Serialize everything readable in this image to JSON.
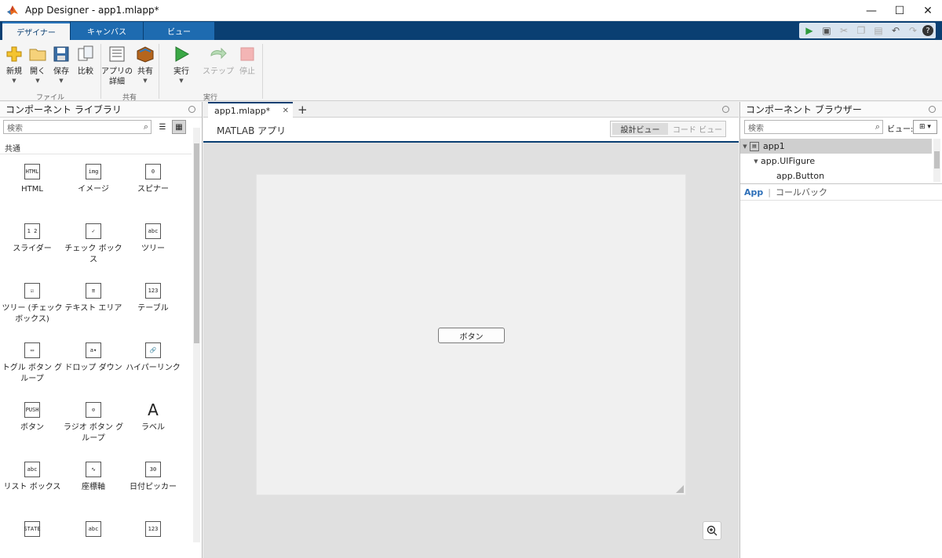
{
  "window": {
    "title": "App Designer - app1.mlapp*"
  },
  "main_tabs": [
    "デザイナー",
    "キャンバス",
    "ビュー"
  ],
  "ribbon": {
    "file_buttons": [
      {
        "label": "新規"
      },
      {
        "label": "開く"
      },
      {
        "label": "保存"
      },
      {
        "label": "比較"
      }
    ],
    "share_buttons": [
      {
        "label": "アプリの\n詳細"
      },
      {
        "label": "共有"
      }
    ],
    "run_buttons": [
      {
        "label": "実行"
      },
      {
        "label": "ステップ"
      },
      {
        "label": "停止"
      }
    ],
    "groups": {
      "file": "ファイル",
      "share": "共有",
      "run": "実行"
    }
  },
  "component_library": {
    "title": "コンポーネント ライブラリ",
    "search_placeholder": "検索",
    "section": "共通",
    "components": [
      {
        "label": "HTML",
        "icon": "HTML"
      },
      {
        "label": "イメージ",
        "icon": "img"
      },
      {
        "label": "スピナー",
        "icon": "0"
      },
      {
        "label": "スライダー",
        "icon": "1 2"
      },
      {
        "label": "チェック ボックス",
        "icon": "✓"
      },
      {
        "label": "ツリー",
        "icon": "abc"
      },
      {
        "label": "ツリー (チェック ボックス)",
        "icon": "☑"
      },
      {
        "label": "テキスト エリア",
        "icon": "≡"
      },
      {
        "label": "テーブル",
        "icon": "123"
      },
      {
        "label": "トグル ボタン グループ",
        "icon": "▭"
      },
      {
        "label": "ドロップ ダウン",
        "icon": "a▾"
      },
      {
        "label": "ハイパーリンク",
        "icon": "🔗"
      },
      {
        "label": "ボタン",
        "icon": "PUSH"
      },
      {
        "label": "ラジオ ボタン グループ",
        "icon": "⊙"
      },
      {
        "label": "ラベル",
        "icon": "A"
      },
      {
        "label": "リスト ボックス",
        "icon": "abc"
      },
      {
        "label": "座標軸",
        "icon": "∿"
      },
      {
        "label": "日付ピッカー",
        "icon": "30"
      },
      {
        "label": "",
        "icon": "STATE"
      },
      {
        "label": "",
        "icon": "abc"
      },
      {
        "label": "",
        "icon": "123"
      }
    ]
  },
  "document": {
    "tab": "app1.mlapp*",
    "app_title": "MATLAB アプリ",
    "views": [
      "設計ビュー",
      "コード ビュー"
    ],
    "button_label": "ボタン"
  },
  "component_browser": {
    "title": "コンポーネント ブラウザー",
    "search_placeholder": "検索",
    "view_label": "ビュー:",
    "tree": [
      "app1",
      "app.UIFigure",
      "app.Button"
    ],
    "tabs": [
      "App",
      "コールバック"
    ]
  },
  "colors": {
    "tabstrip": "#0a3f72",
    "accent": "#2f7ac0",
    "canvas": "#f0f0f0"
  }
}
